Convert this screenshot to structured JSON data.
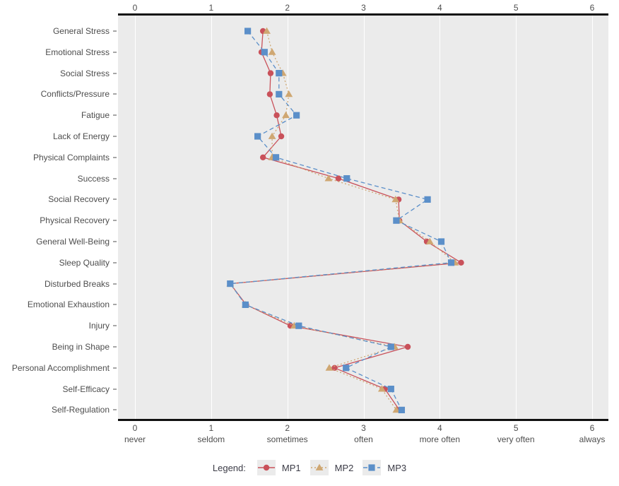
{
  "chart_data": {
    "type": "line",
    "title": "",
    "xlabel": "",
    "ylabel": "",
    "orientation": "horizontal",
    "xlim": [
      0,
      6
    ],
    "grid": true,
    "legend_position": "bottom",
    "legend_title": "Legend:",
    "x_ticks": [
      {
        "value": 0,
        "num": "0",
        "word": "never"
      },
      {
        "value": 1,
        "num": "1",
        "word": "seldom"
      },
      {
        "value": 2,
        "num": "2",
        "word": "sometimes"
      },
      {
        "value": 3,
        "num": "3",
        "word": "often"
      },
      {
        "value": 4,
        "num": "4",
        "word": "more often"
      },
      {
        "value": 5,
        "num": "5",
        "word": "very often"
      },
      {
        "value": 6,
        "num": "6",
        "word": "always"
      }
    ],
    "categories": [
      "General Stress",
      "Emotional Stress",
      "Social Stress",
      "Conflicts/Pressure",
      "Fatigue",
      "Lack of Energy",
      "Physical Complaints",
      "Success",
      "Social Recovery",
      "Physical Recovery",
      "General Well-Being",
      "Sleep Quality",
      "Disturbed Breaks",
      "Emotional Exhaustion",
      "Injury",
      "Being in Shape",
      "Personal Accomplishment",
      "Self-Efficacy",
      "Self-Regulation"
    ],
    "series": [
      {
        "name": "MP1",
        "color": "#c9515a",
        "marker": "circle",
        "linestyle": "solid",
        "values": [
          1.68,
          1.66,
          1.78,
          1.77,
          1.86,
          1.92,
          1.68,
          2.67,
          3.46,
          3.47,
          3.83,
          4.28,
          1.25,
          1.46,
          2.04,
          3.58,
          2.62,
          3.28,
          3.47
        ]
      },
      {
        "name": "MP2",
        "color": "#cfa772",
        "marker": "triangle",
        "linestyle": "dotted",
        "values": [
          1.73,
          1.8,
          1.94,
          2.02,
          1.98,
          1.8,
          1.8,
          2.54,
          3.42,
          3.47,
          3.87,
          4.2,
          1.25,
          1.45,
          2.09,
          3.41,
          2.55,
          3.24,
          3.43
        ]
      },
      {
        "name": "MP3",
        "color": "#5b8fc9",
        "marker": "square",
        "linestyle": "dashed",
        "values": [
          1.48,
          1.7,
          1.89,
          1.89,
          2.12,
          1.61,
          1.85,
          2.78,
          3.84,
          3.43,
          4.02,
          4.15,
          1.25,
          1.45,
          2.15,
          3.36,
          2.77,
          3.36,
          3.5
        ]
      }
    ]
  },
  "legend": {
    "title": "Legend:",
    "entries": [
      {
        "label": "MP1"
      },
      {
        "label": "MP2"
      },
      {
        "label": "MP3"
      }
    ]
  }
}
